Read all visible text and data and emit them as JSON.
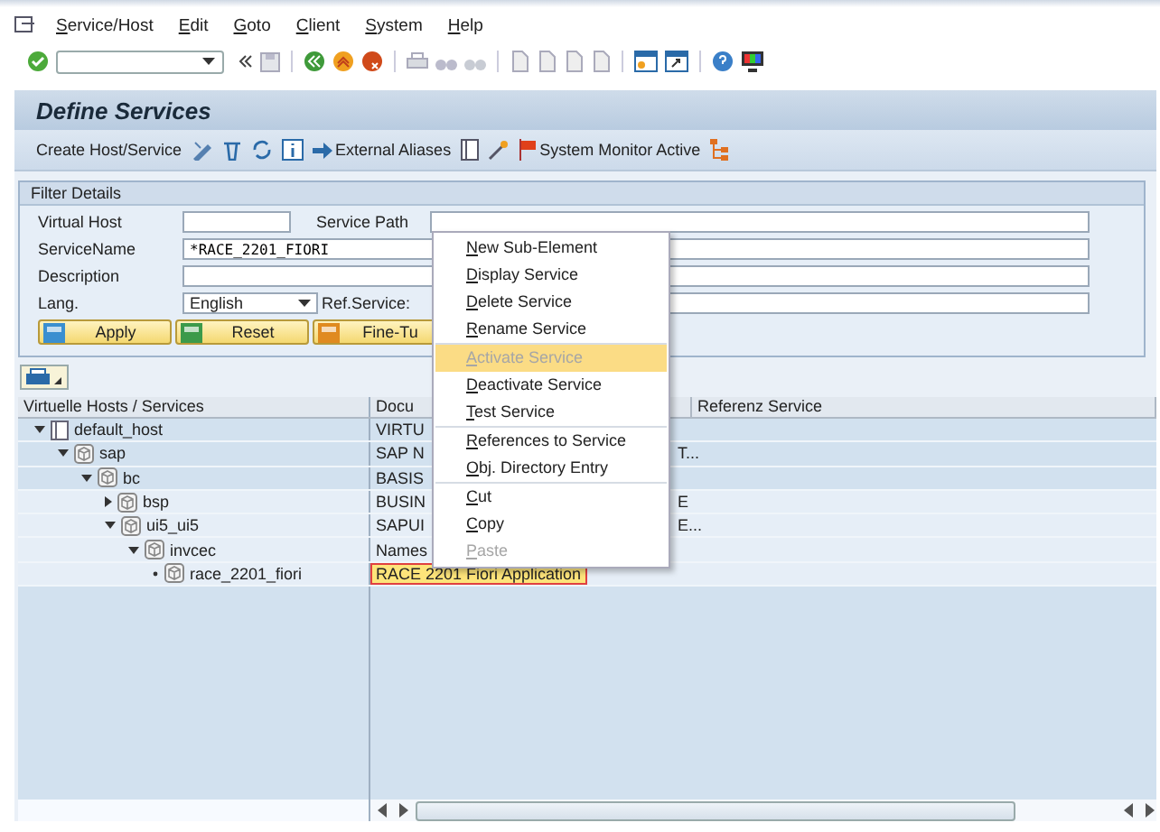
{
  "menu_bar": [
    "Service/Host",
    "Edit",
    "Goto",
    "Client",
    "System",
    "Help"
  ],
  "title": "Define Services",
  "app_toolbar": {
    "create": "Create Host/Service",
    "aliases": "External Aliases",
    "monitor": "System Monitor Active"
  },
  "filter": {
    "title": "Filter Details",
    "virtual_host": {
      "label": "Virtual Host"
    },
    "service_path": {
      "label": "Service Path"
    },
    "service_name": {
      "label": "ServiceName",
      "value": "*RACE_2201_FIORI"
    },
    "description": {
      "label": "Description"
    },
    "lang": {
      "label": "Lang.",
      "value": "English"
    },
    "ref_service": {
      "label": "Ref.Service:"
    },
    "buttons": [
      {
        "kind": "apply",
        "label": "Apply"
      },
      {
        "kind": "reset",
        "label": "Reset"
      },
      {
        "kind": "fine",
        "label": "Fine-Tu"
      }
    ]
  },
  "tree": {
    "columns": [
      "Virtuelle Hosts / Services",
      "Docu",
      "Referenz Service"
    ],
    "rows": [
      {
        "name": "default_host",
        "kind": "host",
        "expanded": true,
        "doc": "VIRTU",
        "selected": false,
        "children": [
          {
            "name": "sap",
            "kind": "service",
            "expanded": true,
            "doc": "SAP N",
            "doc_tail": "T...",
            "selected": false,
            "children": [
              {
                "name": "bc",
                "kind": "service",
                "expanded": true,
                "doc": "BASIS",
                "selected": false,
                "children": [
                  {
                    "name": "bsp",
                    "kind": "service",
                    "expanded": false,
                    "doc": "BUSIN",
                    "doc_tail": "E",
                    "selected": false
                  },
                  {
                    "name": "ui5_ui5",
                    "kind": "service",
                    "expanded": true,
                    "doc": "SAPUI",
                    "doc_tail": "E...",
                    "selected": false,
                    "children": [
                      {
                        "name": "invcec",
                        "kind": "service",
                        "expanded": true,
                        "doc": "Names",
                        "selected": false,
                        "children": [
                          {
                            "name": "race_2201_fiori",
                            "kind": "service",
                            "doc": "RACE 2201 Fiori Application",
                            "selected": true
                          }
                        ]
                      }
                    ]
                  }
                ]
              }
            ]
          }
        ]
      }
    ]
  },
  "context_menu": [
    [
      {
        "label": "New Sub-Element",
        "disabled": false,
        "selected": false
      },
      {
        "label": "Display Service",
        "disabled": false,
        "selected": false
      },
      {
        "label": "Delete Service",
        "disabled": false,
        "selected": false
      },
      {
        "label": "Rename Service",
        "disabled": false,
        "selected": false
      }
    ],
    [
      {
        "label": "Activate Service",
        "disabled": true,
        "selected": true
      },
      {
        "label": "Deactivate Service",
        "disabled": false,
        "selected": false
      },
      {
        "label": "Test Service",
        "disabled": false,
        "selected": false
      }
    ],
    [
      {
        "label": "References to Service",
        "disabled": false,
        "selected": false
      },
      {
        "label": "Obj. Directory Entry",
        "disabled": false,
        "selected": false
      }
    ],
    [
      {
        "label": "Cut",
        "disabled": false,
        "selected": false
      },
      {
        "label": "Copy",
        "disabled": false,
        "selected": false
      },
      {
        "label": "Paste",
        "disabled": true,
        "selected": false
      }
    ]
  ]
}
